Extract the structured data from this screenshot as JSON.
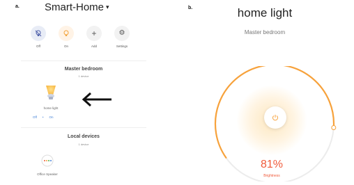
{
  "panels": {
    "a": "a.",
    "b": "b."
  },
  "left": {
    "home_title": "Smart-Home",
    "quick_actions": [
      {
        "label": "Off",
        "icon": "bulb-off-icon"
      },
      {
        "label": "On",
        "icon": "bulb-on-icon"
      },
      {
        "label": "Add",
        "icon": "plus-icon"
      },
      {
        "label": "Settings",
        "icon": "gear-icon"
      }
    ],
    "room": {
      "title": "Master bedroom",
      "subtitle": "1 device",
      "device_name": "home light",
      "off": "Off",
      "separator": "•",
      "on": "On"
    },
    "local": {
      "title": "Local devices",
      "subtitle": "1 device",
      "device_name": "Office Speaker"
    },
    "arrow_icon": "left-arrow-icon"
  },
  "right": {
    "title": "home light",
    "room": "Master bedroom",
    "brightness_percent": 81,
    "brightness_text": "81%",
    "brightness_label": "Brightness",
    "power_icon": "power-icon",
    "accent": "#f7a23b",
    "track": "#ececec"
  }
}
